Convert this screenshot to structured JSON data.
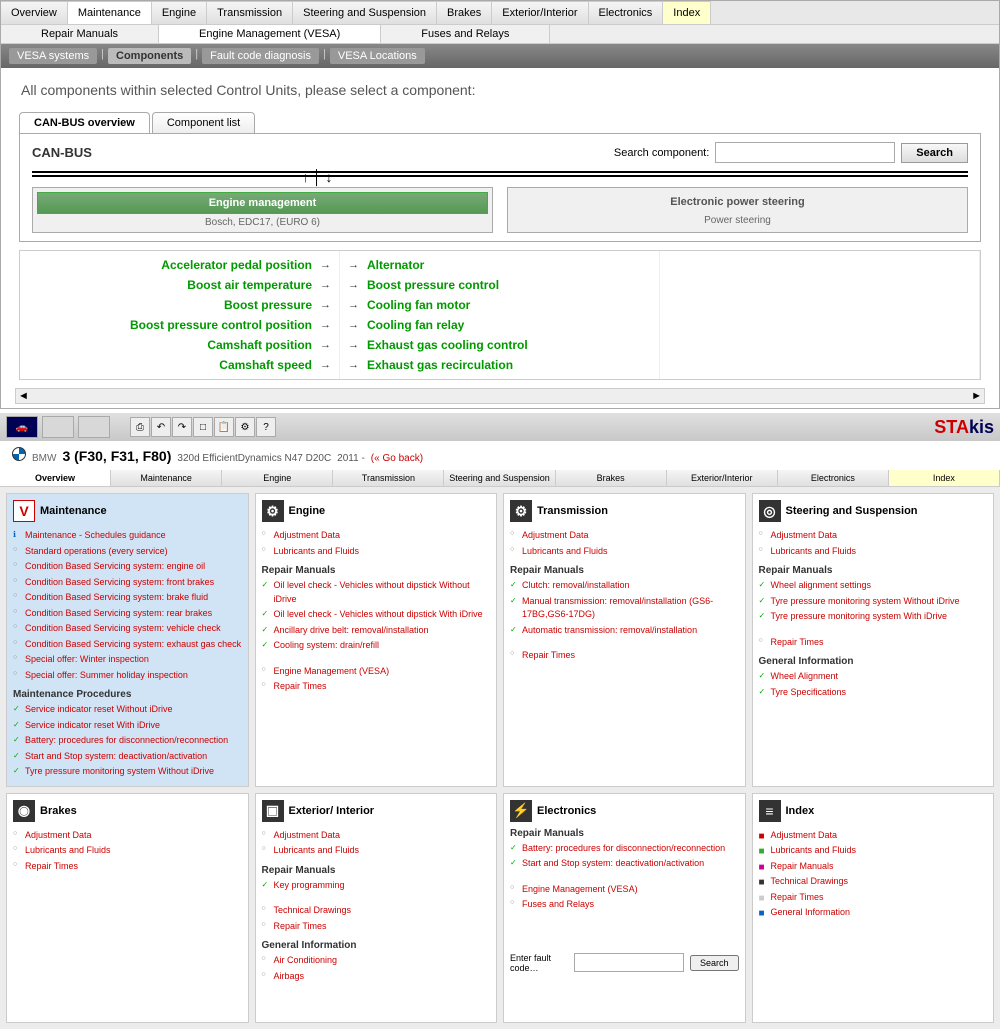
{
  "mainTabs": [
    "Overview",
    "Maintenance",
    "Engine",
    "Transmission",
    "Steering and Suspension",
    "Brakes",
    "Exterior/Interior",
    "Electronics",
    "Index"
  ],
  "mainTabActive": 1,
  "subTabs": [
    "Repair Manuals",
    "Engine Management (VESA)",
    "Fuses and Relays"
  ],
  "vesa": {
    "items": [
      "VESA systems",
      "Components",
      "Fault code diagnosis",
      "VESA Locations"
    ],
    "active": 1
  },
  "instruction": "All components within selected Control Units, please select a component:",
  "ovTabs": [
    "CAN-BUS overview",
    "Component list"
  ],
  "canbus": {
    "title": "CAN-BUS",
    "searchLabel": "Search component:",
    "searchBtn": "Search",
    "units": [
      {
        "title": "Engine management",
        "sub": "Bosch, EDC17, (EURO 6)",
        "active": true
      },
      {
        "title": "Electronic power steering",
        "sub": "Power steering",
        "active": false
      }
    ],
    "leftComps": [
      "Accelerator pedal position",
      "Boost air temperature",
      "Boost pressure",
      "Boost pressure control position",
      "Camshaft position",
      "Camshaft speed"
    ],
    "rightComps": [
      "Alternator",
      "Boost pressure control",
      "Cooling fan motor",
      "Cooling fan relay",
      "Exhaust gas cooling control",
      "Exhaust gas recirculation"
    ]
  },
  "stakis": {
    "a": "STA",
    "b": "kis"
  },
  "model": {
    "brand": "BMW",
    "name": "3 (F30, F31, F80)",
    "variant": "320d EfficientDynamics N47 D20C",
    "year": "2011 -",
    "goback": "(« Go back)"
  },
  "botTabs": [
    "Overview",
    "Maintenance",
    "Engine",
    "Transmission",
    "Steering and Suspension",
    "Brakes",
    "Exterior/Interior",
    "Electronics",
    "Index"
  ],
  "cards": {
    "maintenance": {
      "title": "Maintenance",
      "items": [
        {
          "t": "Maintenance - Schedules guidance",
          "c": "i"
        },
        {
          "t": "Standard operations (every service)",
          "c": "d"
        },
        {
          "t": "Condition Based Servicing system: engine oil",
          "c": "d"
        },
        {
          "t": "Condition Based Servicing system: front brakes",
          "c": "d"
        },
        {
          "t": "Condition Based Servicing system: brake fluid",
          "c": "d"
        },
        {
          "t": "Condition Based Servicing system: rear brakes",
          "c": "d"
        },
        {
          "t": "Condition Based Servicing system: vehicle check",
          "c": "d"
        },
        {
          "t": "Condition Based Servicing system: exhaust gas check",
          "c": "d"
        },
        {
          "t": "Special offer: Winter inspection",
          "c": "d"
        },
        {
          "t": "Special offer: Summer holiday inspection",
          "c": "d"
        }
      ],
      "proc_title": "Maintenance Procedures",
      "procs": [
        {
          "t": "Service indicator reset Without iDrive",
          "c": "g"
        },
        {
          "t": "Service indicator reset With iDrive",
          "c": "g"
        },
        {
          "t": "Battery: procedures for disconnection/reconnection",
          "c": "g"
        },
        {
          "t": "Start and Stop system: deactivation/activation",
          "c": "g"
        },
        {
          "t": "Tyre pressure monitoring system Without iDrive",
          "c": "g"
        }
      ]
    },
    "engine": {
      "title": "Engine",
      "items": [
        {
          "t": "Adjustment Data",
          "c": "d"
        },
        {
          "t": "Lubricants and Fluids",
          "c": "d"
        }
      ],
      "rm_title": "Repair Manuals",
      "rm": [
        {
          "t": "Oil level check - Vehicles without dipstick Without iDrive",
          "c": "g"
        },
        {
          "t": "Oil level check - Vehicles without dipstick With iDrive",
          "c": "g"
        },
        {
          "t": "Ancillary drive belt: removal/installation",
          "c": "g"
        },
        {
          "t": "Cooling system: drain/refill",
          "c": "g"
        }
      ],
      "extra": [
        {
          "t": "Engine Management (VESA)",
          "c": "d"
        },
        {
          "t": "Repair Times",
          "c": "d"
        }
      ]
    },
    "transmission": {
      "title": "Transmission",
      "items": [
        {
          "t": "Adjustment Data",
          "c": "d"
        },
        {
          "t": "Lubricants and Fluids",
          "c": "d"
        }
      ],
      "rm_title": "Repair Manuals",
      "rm": [
        {
          "t": "Clutch: removal/installation",
          "c": "g"
        },
        {
          "t": "Manual transmission: removal/installation (GS6-17BG,GS6-17DG)",
          "c": "g"
        },
        {
          "t": "Automatic transmission: removal/installation",
          "c": "g"
        }
      ],
      "extra": [
        {
          "t": "Repair Times",
          "c": "d"
        }
      ]
    },
    "steering": {
      "title": "Steering and Suspension",
      "items": [
        {
          "t": "Adjustment Data",
          "c": "d"
        },
        {
          "t": "Lubricants and Fluids",
          "c": "d"
        }
      ],
      "rm_title": "Repair Manuals",
      "rm": [
        {
          "t": "Wheel alignment settings",
          "c": "g"
        },
        {
          "t": "Tyre pressure monitoring system Without iDrive",
          "c": "g"
        },
        {
          "t": "Tyre pressure monitoring system With iDrive",
          "c": "g"
        }
      ],
      "extra": [
        {
          "t": "Repair Times",
          "c": "d"
        }
      ],
      "gi_title": "General Information",
      "gi": [
        {
          "t": "Wheel Alignment",
          "c": "g"
        },
        {
          "t": "Tyre Specifications",
          "c": "g"
        }
      ]
    },
    "brakes": {
      "title": "Brakes",
      "items": [
        {
          "t": "Adjustment Data",
          "c": "d"
        },
        {
          "t": "Lubricants and Fluids",
          "c": "d"
        },
        {
          "t": "Repair Times",
          "c": "d"
        }
      ]
    },
    "exterior": {
      "title": "Exterior/ Interior",
      "items": [
        {
          "t": "Adjustment Data",
          "c": "d"
        },
        {
          "t": "Lubricants and Fluids",
          "c": "d"
        }
      ],
      "rm_title": "Repair Manuals",
      "rm": [
        {
          "t": "Key programming",
          "c": "g"
        }
      ],
      "extra": [
        {
          "t": "Technical Drawings",
          "c": "d"
        },
        {
          "t": "Repair Times",
          "c": "d"
        }
      ],
      "gi_title": "General Information",
      "gi": [
        {
          "t": "Air Conditioning",
          "c": "d"
        },
        {
          "t": "Airbags",
          "c": "d"
        }
      ]
    },
    "electronics": {
      "title": "Electronics",
      "rm_title": "Repair Manuals",
      "rm": [
        {
          "t": "Battery: procedures for disconnection/reconnection",
          "c": "g"
        },
        {
          "t": "Start and Stop system: deactivation/activation",
          "c": "g"
        }
      ],
      "extra": [
        {
          "t": "Engine Management (VESA)",
          "c": "d"
        },
        {
          "t": "Fuses and Relays",
          "c": "d"
        }
      ]
    },
    "index": {
      "title": "Index",
      "items": [
        {
          "t": "Adjustment Data",
          "c": "idx c1"
        },
        {
          "t": "Lubricants and Fluids",
          "c": "idx c2"
        },
        {
          "t": "Repair Manuals",
          "c": "idx c3"
        },
        {
          "t": "Technical Drawings",
          "c": "idx c4"
        },
        {
          "t": "Repair Times",
          "c": "idx c5"
        },
        {
          "t": "General Information",
          "c": "idx c6"
        }
      ]
    }
  },
  "faultLabel": "Enter fault code…",
  "faultBtn": "Search"
}
